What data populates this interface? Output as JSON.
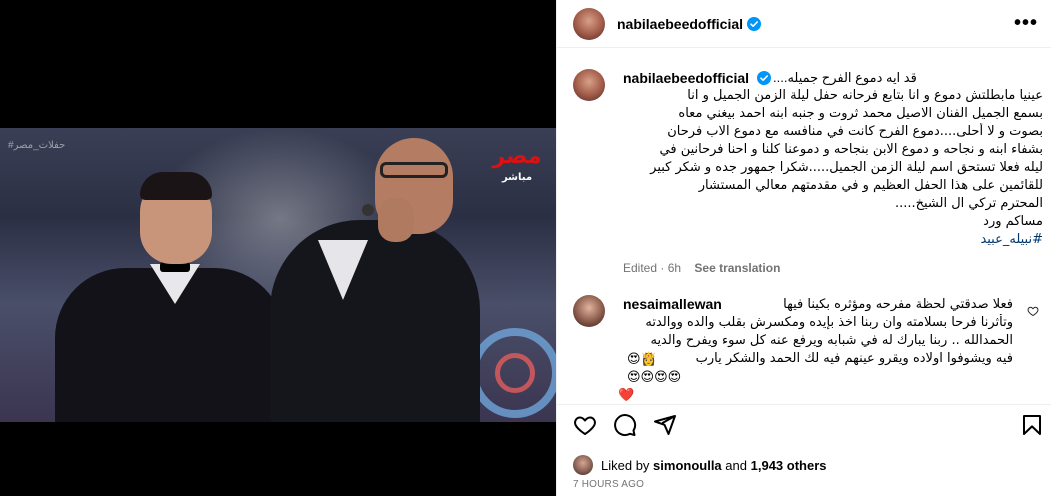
{
  "post": {
    "username": "nabilaebeedofficial",
    "more_label": "•••",
    "media": {
      "channel_logo": "مصر",
      "channel_sub": "مباشر",
      "watermark": "#حفلات_مصر"
    }
  },
  "caption": {
    "username": "nabilaebeedofficial",
    "first_line": "قد ايه دموع الفرح جميله....",
    "lines": [
      "عينيا مابطلتش دموع و انا بتابع فرحانه حفل ليلة الزمن الجميل و انا",
      "بسمع الجميل الفنان الاصيل محمد ثروت و جنبه ابنه احمد بيغني معاه",
      "بصوت و لا أحلى....دموع الفرح كانت في منافسه مع دموع الاب فرحان",
      "بشفاء ابنه و نجاحه و دموع الابن بنجاحه و دموعنا كلنا و احنا فرحانين في",
      "ليله فعلا تستحق اسم ليلة الزمن الجميل.....شكرا جمهور جده و شكر كبير",
      "للقائمين على هذا الحفل العظيم و في مقدمتهم معالي المستشار",
      "المحترم تركي ال الشيخ.....",
      "مساكم ورد"
    ],
    "hashtag": "#نبيله_عبيد",
    "edited": "Edited · 6h",
    "see_translation": "See translation"
  },
  "comment": {
    "username": "nesaimallewan",
    "lines": [
      "فعلا صدقتي لحظة مفرحه ومؤثره بكينا فيها",
      "وتأثرنا فرحا بسلامته وان ربنا اخذ بإيده ومكسرش بقلب والده ووالدته",
      "الحمدالله .. ربنا يبارك له في شبابه ويرفع عنه كل سوء ويفرح والديه",
      "فيه ويشوفوا اولاده ويقرو عينهم فيه لك الحمد والشكر يارب"
    ],
    "emoji_line_1": "😍👸",
    "emoji_line_2": "😍😍😍😍",
    "emoji_line_3": "❤️"
  },
  "actions": {
    "icons": [
      "heart-icon",
      "comment-icon",
      "share-icon",
      "bookmark-icon"
    ]
  },
  "likes": {
    "prefix": "Liked by",
    "user": "simonoulla",
    "middle": "and",
    "count": "1,943 others"
  },
  "timestamp": "7 HOURS AGO"
}
